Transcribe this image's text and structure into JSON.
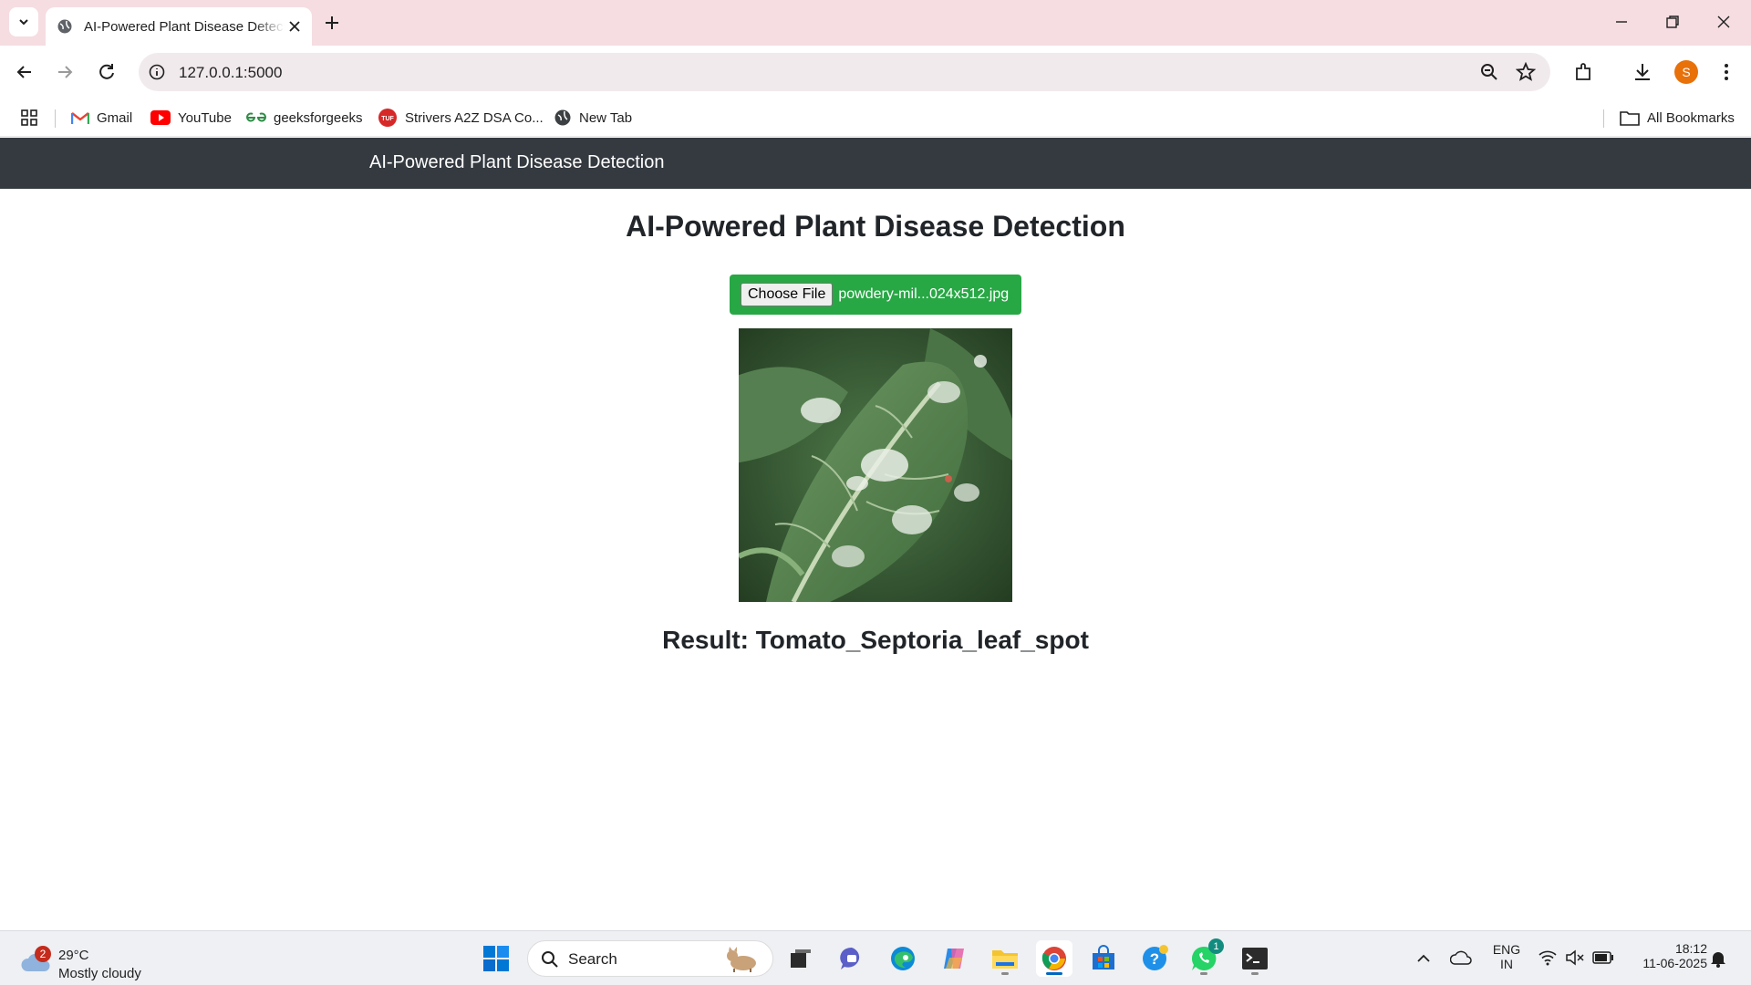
{
  "browser": {
    "tab": {
      "title": "AI-Powered Plant Disease Detection"
    },
    "address_bar": {
      "url": "127.0.0.1:5000"
    },
    "profile_initial": "S",
    "bookmarks": [
      {
        "label": "Gmail",
        "icon": "gmail-icon"
      },
      {
        "label": "YouTube",
        "icon": "youtube-icon"
      },
      {
        "label": "geeksforgeeks",
        "icon": "gfg-icon"
      },
      {
        "label": "Strivers A2Z DSA Co...",
        "icon": "tuf-icon"
      },
      {
        "label": "New Tab",
        "icon": "globe-icon"
      }
    ],
    "all_bookmarks_label": "All Bookmarks"
  },
  "page": {
    "navbar_brand": "AI-Powered Plant Disease Detection",
    "heading": "AI-Powered Plant Disease Detection",
    "file_input": {
      "button_label": "Choose File",
      "file_name": "powdery-mil...024x512.jpg"
    },
    "preview_image": {
      "subject": "tomato leaf with white powdery mildew patches"
    },
    "result_text": "Result: Tomato_Septoria_leaf_spot",
    "colors": {
      "navbar": "#343a40",
      "upload_bg": "#28a745"
    }
  },
  "taskbar": {
    "weather": {
      "temp": "29°C",
      "desc": "Mostly cloudy",
      "badge": "2"
    },
    "search_label": "Search",
    "whatsapp_badge": "1",
    "language": {
      "line1": "ENG",
      "line2": "IN"
    },
    "clock": {
      "time": "18:12",
      "date": "11-06-2025"
    }
  }
}
